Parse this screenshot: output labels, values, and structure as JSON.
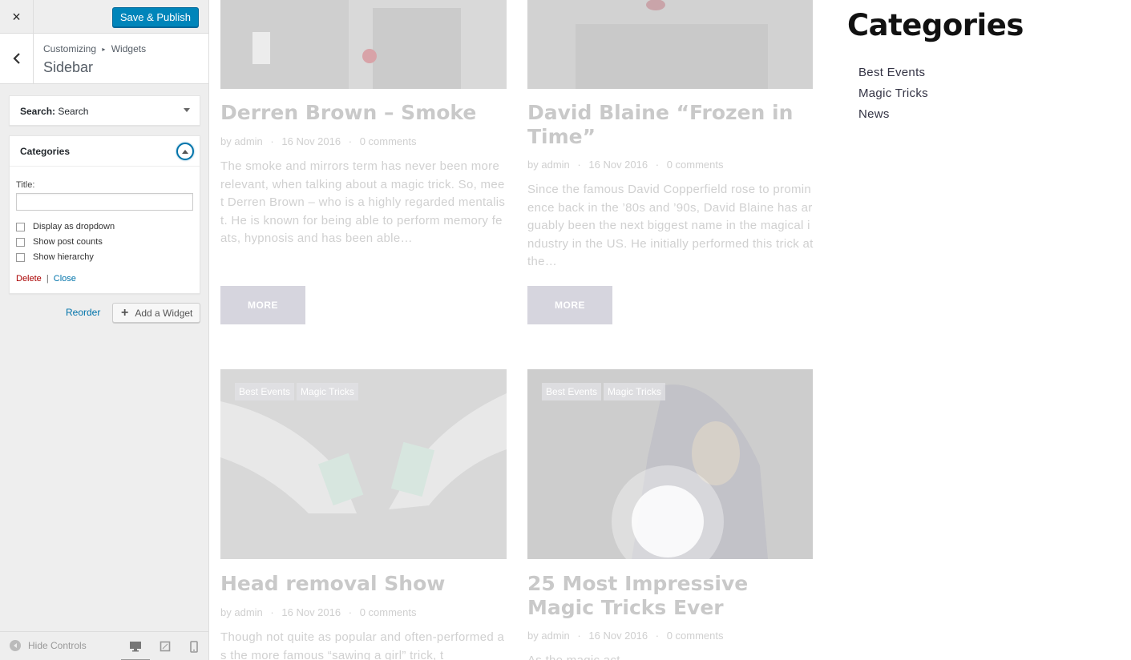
{
  "customizer": {
    "close_icon": "×",
    "save_label": "Save & Publish",
    "breadcrumb": {
      "parent": "Customizing",
      "separator": "▸",
      "current": "Widgets"
    },
    "section_title": "Sidebar",
    "widgets": {
      "search": {
        "label": "Search:",
        "title": "Search"
      },
      "categories": {
        "label": "Categories",
        "title_field_label": "Title:",
        "title_value": "",
        "options": [
          {
            "label": "Display as dropdown",
            "checked": false
          },
          {
            "label": "Show post counts",
            "checked": false
          },
          {
            "label": "Show hierarchy",
            "checked": false
          }
        ],
        "delete_label": "Delete",
        "separator": "|",
        "close_label": "Close"
      }
    },
    "reorder_label": "Reorder",
    "add_widget_label": "Add a Widget",
    "footer": {
      "hide_controls_label": "Hide Controls"
    }
  },
  "preview": {
    "posts": [
      {
        "title": "Derren Brown – Smoke",
        "author": "admin",
        "date": "16 Nov 2016",
        "comments": "0 comments",
        "excerpt": "The smoke and mirrors term has never been more relevant, when talking about a magic trick. So, meet Derren Brown – who is a highly regarded mentalist. He is known for being able to perform memory feats, hypnosis and has been able…",
        "more": "MORE"
      },
      {
        "title": "David Blaine “Frozen in Time”",
        "author": "admin",
        "date": "16 Nov 2016",
        "comments": "0 comments",
        "excerpt": "Since the famous David Copperfield rose to prominence back in the ’80s and ’90s, David Blaine has arguably been the next biggest name in the magical industry in the US. He initially performed this trick at the…",
        "more": "MORE"
      },
      {
        "tags": [
          "Best Events",
          "Magic Tricks"
        ],
        "title": "Head removal Show",
        "author": "admin",
        "date": "16 Nov 2016",
        "comments": "0 comments",
        "excerpt": "Though not quite as popular and often-performed as the more famous “sawing a girl” trick, t"
      },
      {
        "tags": [
          "Best Events",
          "Magic Tricks"
        ],
        "title": "25 Most Impressive Magic Tricks Ever",
        "author": "admin",
        "date": "16 Nov 2016",
        "comments": "0 comments",
        "excerpt": "As the magic act..."
      }
    ],
    "meta_by": "by",
    "meta_sep": "·",
    "sidebar": {
      "heading": "Categories",
      "items": [
        "Best Events",
        "Magic Tricks",
        "News"
      ]
    }
  },
  "colors": {
    "primary_button": "#0085ba",
    "link": "#0073aa",
    "delete": "#aa0000",
    "more_button": "#d6d5de"
  }
}
